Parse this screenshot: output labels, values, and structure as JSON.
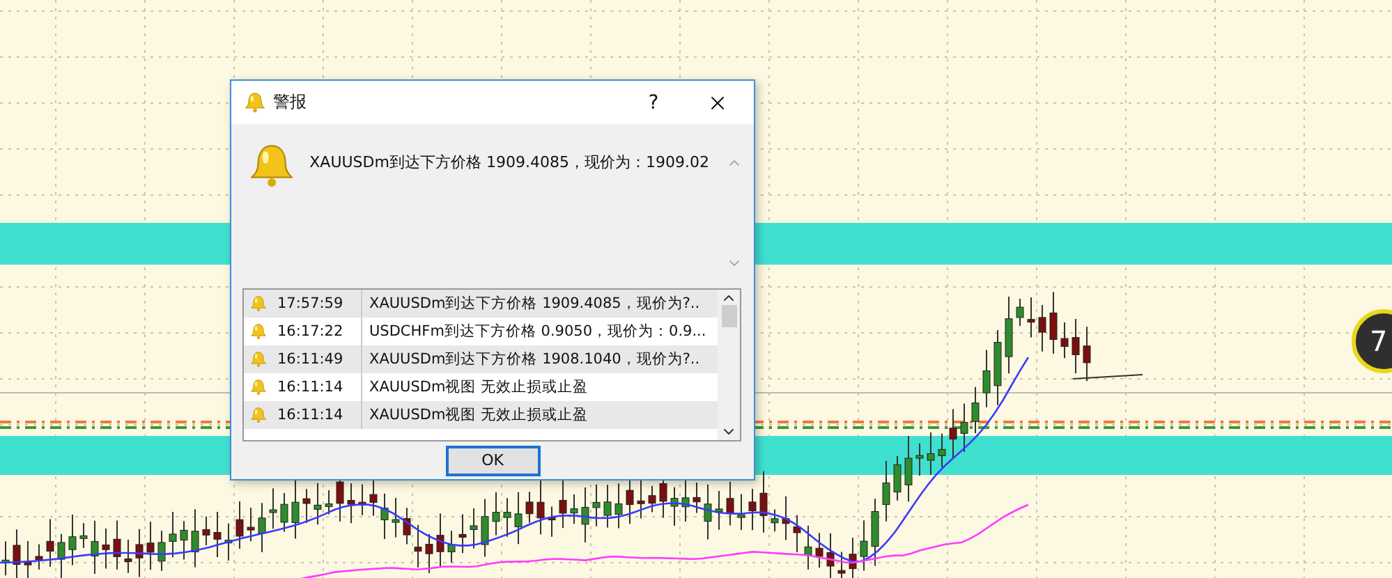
{
  "dialog": {
    "title": "警报",
    "help_button": "?",
    "message": "XAUUSDm到达下方价格 1909.4085，现价为：1909.02",
    "alerts": [
      {
        "time": "17:57:59",
        "message": "XAUUSDm到达下方价格 1909.4085，现价为?.."
      },
      {
        "time": "16:17:22",
        "message": "USDCHFm到达下方价格 0.9050，现价为：0.9..."
      },
      {
        "time": "16:11:49",
        "message": "XAUUSDm到达下方价格 1908.1040，现价为?.."
      },
      {
        "time": "16:11:14",
        "message": "XAUUSDm视图 无效止损或止盈"
      },
      {
        "time": "16:11:14",
        "message": "XAUUSDm视图 无效止损或止盈"
      }
    ],
    "ok_button": "OK"
  },
  "chart": {
    "badge": "7"
  }
}
